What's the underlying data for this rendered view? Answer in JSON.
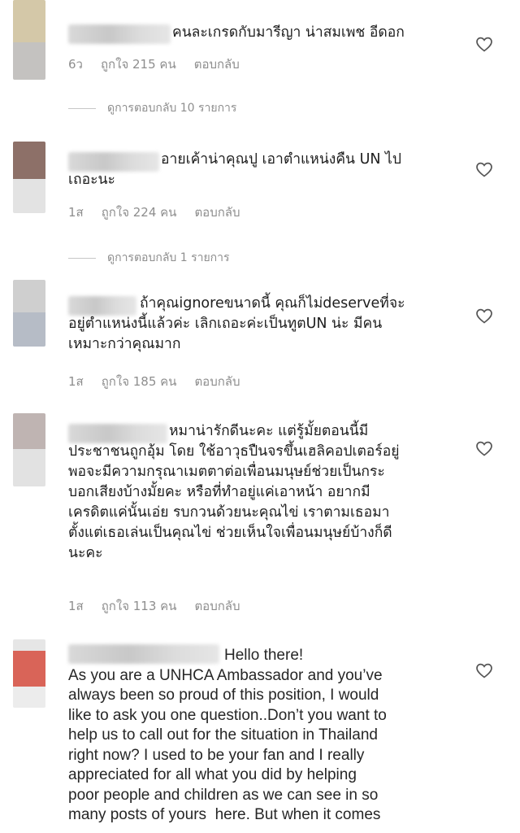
{
  "comments": [
    {
      "text": "คนละเกรดกับมารีญา น่าสมเพช อีดอก",
      "time": "6ว",
      "likes": "ถูกใจ 215 คน",
      "reply_label": "ตอบกลับ",
      "view_replies": "ดูการตอบกลับ 10 รายการ"
    },
    {
      "text": "อายเค้าน่าคุณปู เอาตำแหน่งคืน UN ไป\nเถอะนะ",
      "time": "1ส",
      "likes": "ถูกใจ 224 คน",
      "reply_label": "ตอบกลับ",
      "view_replies": "ดูการตอบกลับ 1 รายการ"
    },
    {
      "text": "ถ้าคุณignoreขนาดนี้ คุณก็ไม่deserveที่จะ\nอยู่ตำแหน่งนี้แล้วค่ะ เลิกเถอะค่ะเป็นทูตUN น่ะ มีคน\nเหมาะกว่าคุณมาก",
      "time": "1ส",
      "likes": "ถูกใจ 185 คน",
      "reply_label": "ตอบกลับ"
    },
    {
      "text": "หมาน่ารักดีนะคะ แต่รู้มั้ยตอนนี้มี\nประชาชนถูกอุ้ม โดย ใช้อาวุธปืนจรขึ้นเฮลิคอปเตอร์อยู่\nพอจะมีความกรุณาเมตตาต่อเพื่อนมนุษย์ช่วยเป็นกระ\nบอกเสียงบ้างมั้ยคะ หรือที่ทำอยู่แค่เอาหน้า อยากมี\nเครดิตแค่นั้นเอ่ย รบกวนด้วยนะคุณไข่ เราตามเธอมา\nตั้งแต่เธอเล่นเป็นคุณไข่ ช่วยเห็นใจเพื่อนมนุษย์บ้างก็ดี\nนะคะ",
      "time": "1ส",
      "likes": "ถูกใจ 113 คน",
      "reply_label": "ตอบกลับ"
    },
    {
      "text": "Hello there!\nAs you are a UNHCA Ambassador and you’ve\nalways been so proud of this position, I would\nlike to ask you one question..Don’t you want to\nhelp us to call out for the situation in Thailand\nright now? I used to be your fan and I really\nappreciated for all what you did by helping\npoor people and children as we can see in so\nmany posts of yours  here. But when it comes"
    }
  ],
  "icons": {
    "heart": "heart-outline-icon"
  },
  "colors": {
    "meta": "#8e8e8e",
    "text": "#262626",
    "divider": "#c7c7c7"
  }
}
